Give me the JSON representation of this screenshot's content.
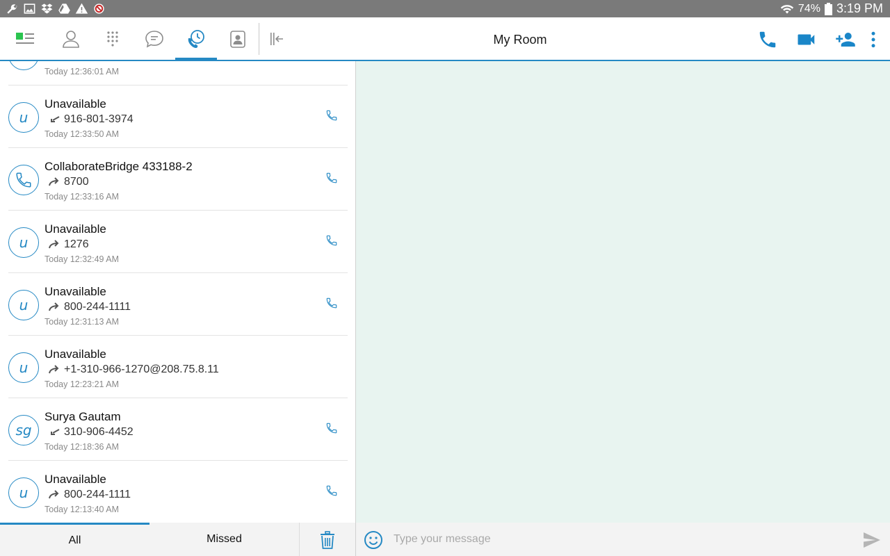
{
  "status_bar": {
    "left_icons": [
      "wrench-icon",
      "image-icon",
      "dropbox-icon",
      "drive-icon",
      "warning-icon",
      "badge-icon"
    ],
    "battery": "74%",
    "time": "3:19 PM"
  },
  "toolbar": {
    "tabs": [
      {
        "name": "dashboard-tab",
        "icon": "dashboard-icon",
        "active": false
      },
      {
        "name": "contacts-tab",
        "icon": "person-icon",
        "active": false
      },
      {
        "name": "dialpad-tab",
        "icon": "dialpad-icon",
        "active": false
      },
      {
        "name": "chat-tab",
        "icon": "chat-bubble-icon",
        "active": false
      },
      {
        "name": "call-history-tab",
        "icon": "call-history-icon",
        "active": true
      },
      {
        "name": "directory-tab",
        "icon": "contact-card-icon",
        "active": false
      }
    ],
    "title": "My Room",
    "accent": "#2589c4"
  },
  "calls": [
    {
      "name": "",
      "direction": "outgoing",
      "number": "",
      "time": "Today 12:36:01 AM",
      "initials": "",
      "avatar_icon": "",
      "has_call_button": false
    },
    {
      "name": "Unavailable",
      "direction": "incoming",
      "number": "916-801-3974",
      "time": "Today 12:33:50 AM",
      "initials": "u",
      "avatar_icon": "",
      "has_call_button": true
    },
    {
      "name": "CollaborateBridge 433188-2",
      "direction": "outgoing",
      "number": "8700",
      "time": "Today 12:33:16 AM",
      "initials": "",
      "avatar_icon": "phone-icon",
      "has_call_button": true
    },
    {
      "name": "Unavailable",
      "direction": "outgoing",
      "number": "1276",
      "time": "Today 12:32:49 AM",
      "initials": "u",
      "avatar_icon": "",
      "has_call_button": true
    },
    {
      "name": "Unavailable",
      "direction": "outgoing",
      "number": "800-244-1111",
      "time": "Today 12:31:13 AM",
      "initials": "u",
      "avatar_icon": "",
      "has_call_button": true
    },
    {
      "name": "Unavailable",
      "direction": "outgoing",
      "number": "+1-310-966-1270@208.75.8.11",
      "time": "Today 12:23:21 AM",
      "initials": "u",
      "avatar_icon": "",
      "has_call_button": false
    },
    {
      "name": "Surya Gautam",
      "direction": "incoming",
      "number": "310-906-4452",
      "time": "Today 12:18:36 AM",
      "initials": "sg",
      "avatar_icon": "",
      "has_call_button": true
    },
    {
      "name": "Unavailable",
      "direction": "outgoing",
      "number": "800-244-1111",
      "time": "Today 12:13:40 AM",
      "initials": "u",
      "avatar_icon": "",
      "has_call_button": true
    }
  ],
  "bottom_tabs": {
    "all": "All",
    "missed": "Missed"
  },
  "composer": {
    "placeholder": "Type your message"
  }
}
